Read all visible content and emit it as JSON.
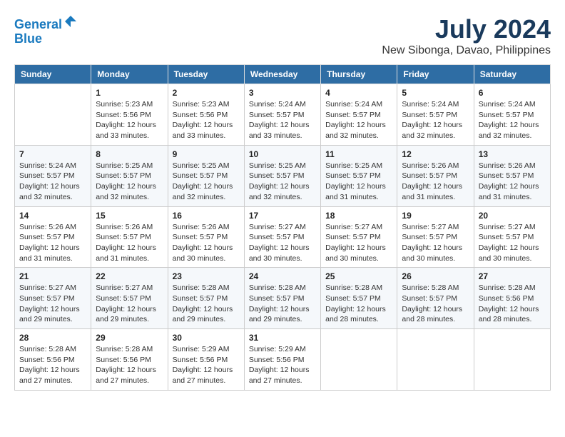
{
  "header": {
    "logo_line1": "General",
    "logo_line2": "Blue",
    "main_title": "July 2024",
    "subtitle": "New Sibonga, Davao, Philippines"
  },
  "weekdays": [
    "Sunday",
    "Monday",
    "Tuesday",
    "Wednesday",
    "Thursday",
    "Friday",
    "Saturday"
  ],
  "weeks": [
    [
      {
        "day": "",
        "detail": ""
      },
      {
        "day": "1",
        "detail": "Sunrise: 5:23 AM\nSunset: 5:56 PM\nDaylight: 12 hours\nand 33 minutes."
      },
      {
        "day": "2",
        "detail": "Sunrise: 5:23 AM\nSunset: 5:56 PM\nDaylight: 12 hours\nand 33 minutes."
      },
      {
        "day": "3",
        "detail": "Sunrise: 5:24 AM\nSunset: 5:57 PM\nDaylight: 12 hours\nand 33 minutes."
      },
      {
        "day": "4",
        "detail": "Sunrise: 5:24 AM\nSunset: 5:57 PM\nDaylight: 12 hours\nand 32 minutes."
      },
      {
        "day": "5",
        "detail": "Sunrise: 5:24 AM\nSunset: 5:57 PM\nDaylight: 12 hours\nand 32 minutes."
      },
      {
        "day": "6",
        "detail": "Sunrise: 5:24 AM\nSunset: 5:57 PM\nDaylight: 12 hours\nand 32 minutes."
      }
    ],
    [
      {
        "day": "7",
        "detail": "Sunrise: 5:24 AM\nSunset: 5:57 PM\nDaylight: 12 hours\nand 32 minutes."
      },
      {
        "day": "8",
        "detail": "Sunrise: 5:25 AM\nSunset: 5:57 PM\nDaylight: 12 hours\nand 32 minutes."
      },
      {
        "day": "9",
        "detail": "Sunrise: 5:25 AM\nSunset: 5:57 PM\nDaylight: 12 hours\nand 32 minutes."
      },
      {
        "day": "10",
        "detail": "Sunrise: 5:25 AM\nSunset: 5:57 PM\nDaylight: 12 hours\nand 32 minutes."
      },
      {
        "day": "11",
        "detail": "Sunrise: 5:25 AM\nSunset: 5:57 PM\nDaylight: 12 hours\nand 31 minutes."
      },
      {
        "day": "12",
        "detail": "Sunrise: 5:26 AM\nSunset: 5:57 PM\nDaylight: 12 hours\nand 31 minutes."
      },
      {
        "day": "13",
        "detail": "Sunrise: 5:26 AM\nSunset: 5:57 PM\nDaylight: 12 hours\nand 31 minutes."
      }
    ],
    [
      {
        "day": "14",
        "detail": "Sunrise: 5:26 AM\nSunset: 5:57 PM\nDaylight: 12 hours\nand 31 minutes."
      },
      {
        "day": "15",
        "detail": "Sunrise: 5:26 AM\nSunset: 5:57 PM\nDaylight: 12 hours\nand 31 minutes."
      },
      {
        "day": "16",
        "detail": "Sunrise: 5:26 AM\nSunset: 5:57 PM\nDaylight: 12 hours\nand 30 minutes."
      },
      {
        "day": "17",
        "detail": "Sunrise: 5:27 AM\nSunset: 5:57 PM\nDaylight: 12 hours\nand 30 minutes."
      },
      {
        "day": "18",
        "detail": "Sunrise: 5:27 AM\nSunset: 5:57 PM\nDaylight: 12 hours\nand 30 minutes."
      },
      {
        "day": "19",
        "detail": "Sunrise: 5:27 AM\nSunset: 5:57 PM\nDaylight: 12 hours\nand 30 minutes."
      },
      {
        "day": "20",
        "detail": "Sunrise: 5:27 AM\nSunset: 5:57 PM\nDaylight: 12 hours\nand 30 minutes."
      }
    ],
    [
      {
        "day": "21",
        "detail": "Sunrise: 5:27 AM\nSunset: 5:57 PM\nDaylight: 12 hours\nand 29 minutes."
      },
      {
        "day": "22",
        "detail": "Sunrise: 5:27 AM\nSunset: 5:57 PM\nDaylight: 12 hours\nand 29 minutes."
      },
      {
        "day": "23",
        "detail": "Sunrise: 5:28 AM\nSunset: 5:57 PM\nDaylight: 12 hours\nand 29 minutes."
      },
      {
        "day": "24",
        "detail": "Sunrise: 5:28 AM\nSunset: 5:57 PM\nDaylight: 12 hours\nand 29 minutes."
      },
      {
        "day": "25",
        "detail": "Sunrise: 5:28 AM\nSunset: 5:57 PM\nDaylight: 12 hours\nand 28 minutes."
      },
      {
        "day": "26",
        "detail": "Sunrise: 5:28 AM\nSunset: 5:57 PM\nDaylight: 12 hours\nand 28 minutes."
      },
      {
        "day": "27",
        "detail": "Sunrise: 5:28 AM\nSunset: 5:56 PM\nDaylight: 12 hours\nand 28 minutes."
      }
    ],
    [
      {
        "day": "28",
        "detail": "Sunrise: 5:28 AM\nSunset: 5:56 PM\nDaylight: 12 hours\nand 27 minutes."
      },
      {
        "day": "29",
        "detail": "Sunrise: 5:28 AM\nSunset: 5:56 PM\nDaylight: 12 hours\nand 27 minutes."
      },
      {
        "day": "30",
        "detail": "Sunrise: 5:29 AM\nSunset: 5:56 PM\nDaylight: 12 hours\nand 27 minutes."
      },
      {
        "day": "31",
        "detail": "Sunrise: 5:29 AM\nSunset: 5:56 PM\nDaylight: 12 hours\nand 27 minutes."
      },
      {
        "day": "",
        "detail": ""
      },
      {
        "day": "",
        "detail": ""
      },
      {
        "day": "",
        "detail": ""
      }
    ]
  ]
}
